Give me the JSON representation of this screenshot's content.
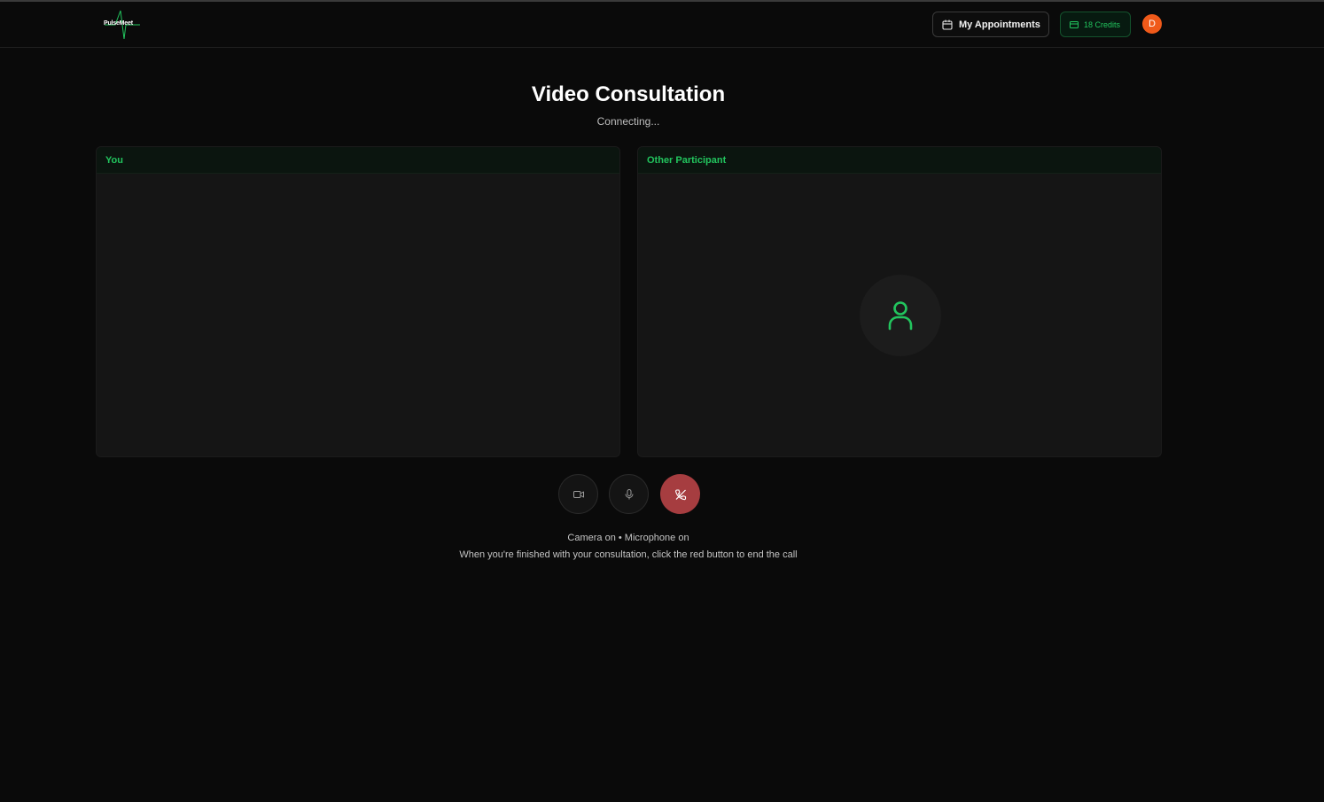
{
  "app": {
    "name": "PulseMeet"
  },
  "header": {
    "appointments_label": "My Appointments",
    "credits_label": "18 Credits",
    "avatar_initial": "D"
  },
  "main": {
    "title": "Video Consultation",
    "status": "Connecting...",
    "local_panel_label": "You",
    "remote_panel_label": "Other Participant"
  },
  "controls": {
    "camera_icon": "video-camera-icon",
    "mic_icon": "microphone-icon",
    "end_icon": "phone-off-icon"
  },
  "footer": {
    "media_status": "Camera on • Microphone on",
    "hint": "When you're finished with your consultation, click the red button to end the call"
  },
  "colors": {
    "background": "#0a0a0a",
    "accent": "#22c55e",
    "end_call": "#a63d40",
    "avatar": "#f05a1a"
  }
}
